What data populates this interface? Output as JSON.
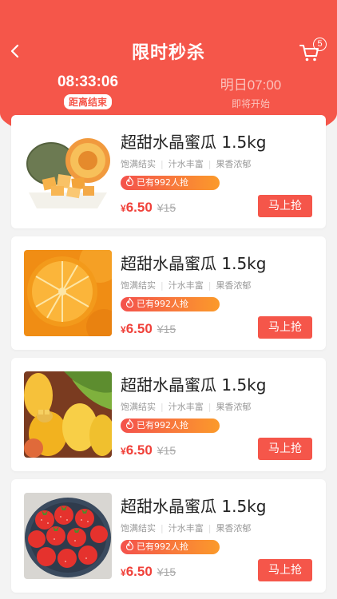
{
  "header": {
    "title": "限时秒杀",
    "cart_count": "5",
    "colors": {
      "primary": "#f5564a",
      "price": "#f0413a"
    }
  },
  "tabs": [
    {
      "time": "08:33:06",
      "label": "距离结束",
      "active": true
    },
    {
      "time": "明日07:00",
      "label": "即将开始",
      "active": false
    }
  ],
  "products": [
    {
      "image": "cantaloupe-image",
      "title": "超甜水晶蜜瓜 1.5kg",
      "tags": [
        "饱满结实",
        "汁水丰富",
        "果香浓郁"
      ],
      "sold": "已有992人抢",
      "currency": "¥",
      "price": "6.50",
      "original_price": "¥15",
      "button": "马上抢"
    },
    {
      "image": "orange-image",
      "title": "超甜水晶蜜瓜 1.5kg",
      "tags": [
        "饱满结实",
        "汁水丰富",
        "果香浓郁"
      ],
      "sold": "已有992人抢",
      "currency": "¥",
      "price": "6.50",
      "original_price": "¥15",
      "button": "马上抢"
    },
    {
      "image": "mango-image",
      "title": "超甜水晶蜜瓜 1.5kg",
      "tags": [
        "饱满结实",
        "汁水丰富",
        "果香浓郁"
      ],
      "sold": "已有992人抢",
      "currency": "¥",
      "price": "6.50",
      "original_price": "¥15",
      "button": "马上抢"
    },
    {
      "image": "strawberry-image",
      "title": "超甜水晶蜜瓜 1.5kg",
      "tags": [
        "饱满结实",
        "汁水丰富",
        "果香浓郁"
      ],
      "sold": "已有992人抢",
      "currency": "¥",
      "price": "6.50",
      "original_price": "¥15",
      "button": "马上抢"
    }
  ]
}
